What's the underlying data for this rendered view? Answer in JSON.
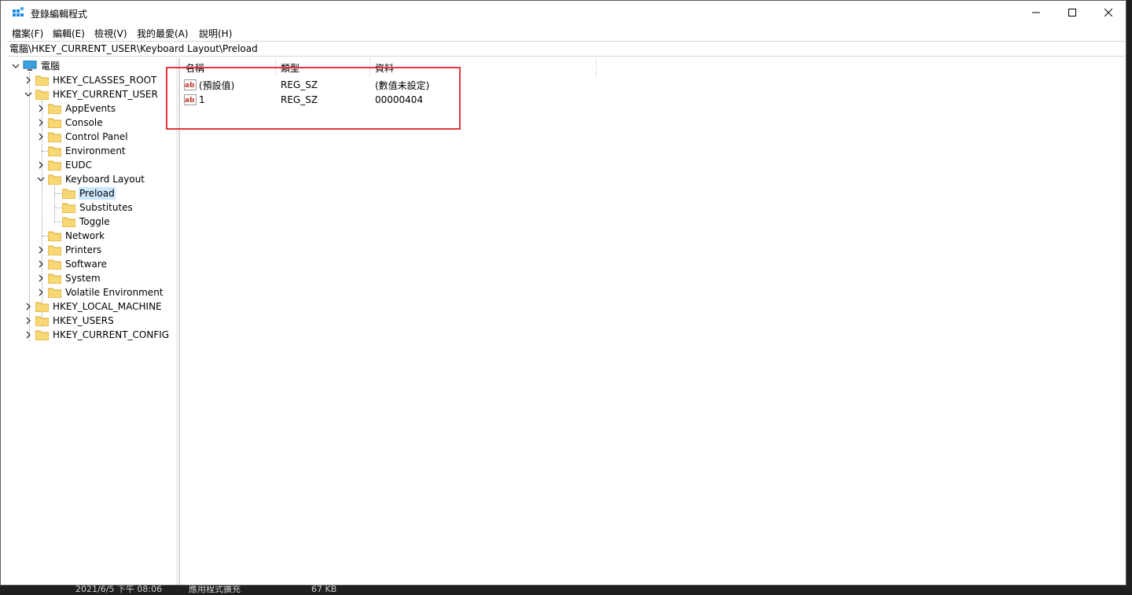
{
  "window": {
    "title": "登錄編輯程式",
    "controls": [
      "minimize",
      "maximize",
      "close"
    ]
  },
  "menu": [
    "檔案(F)",
    "編輯(E)",
    "檢視(V)",
    "我的最愛(A)",
    "說明(H)"
  ],
  "address": "電腦\\HKEY_CURRENT_USER\\Keyboard Layout\\Preload",
  "tree": {
    "root": "電腦",
    "hives": {
      "classes_root": "HKEY_CLASSES_ROOT",
      "current_user": "HKEY_CURRENT_USER",
      "local_machine": "HKEY_LOCAL_MACHINE",
      "users": "HKEY_USERS",
      "current_config": "HKEY_CURRENT_CONFIG"
    },
    "current_user_children": [
      "AppEvents",
      "Console",
      "Control Panel",
      "Environment",
      "EUDC",
      "Keyboard Layout",
      "Network",
      "Printers",
      "Software",
      "System",
      "Volatile Environment"
    ],
    "keyboard_layout_children": [
      "Preload",
      "Substitutes",
      "Toggle"
    ],
    "selected": "Preload"
  },
  "list": {
    "columns": [
      "名稱",
      "類型",
      "資料"
    ],
    "rows": [
      {
        "name": "(預設值)",
        "type": "REG_SZ",
        "data": "(數值未設定)",
        "icon": "string-value-icon"
      },
      {
        "name": "1",
        "type": "REG_SZ",
        "data": "00000404",
        "icon": "string-value-icon"
      }
    ]
  },
  "background_taskbar": {
    "date": "2021/6/5 下午 08:06",
    "kind": "應用程式擴充",
    "size": "67 KB"
  },
  "colors": {
    "highlight_box": "#e0373b",
    "selection": "#cce8ff",
    "folder": "#f8d775"
  }
}
